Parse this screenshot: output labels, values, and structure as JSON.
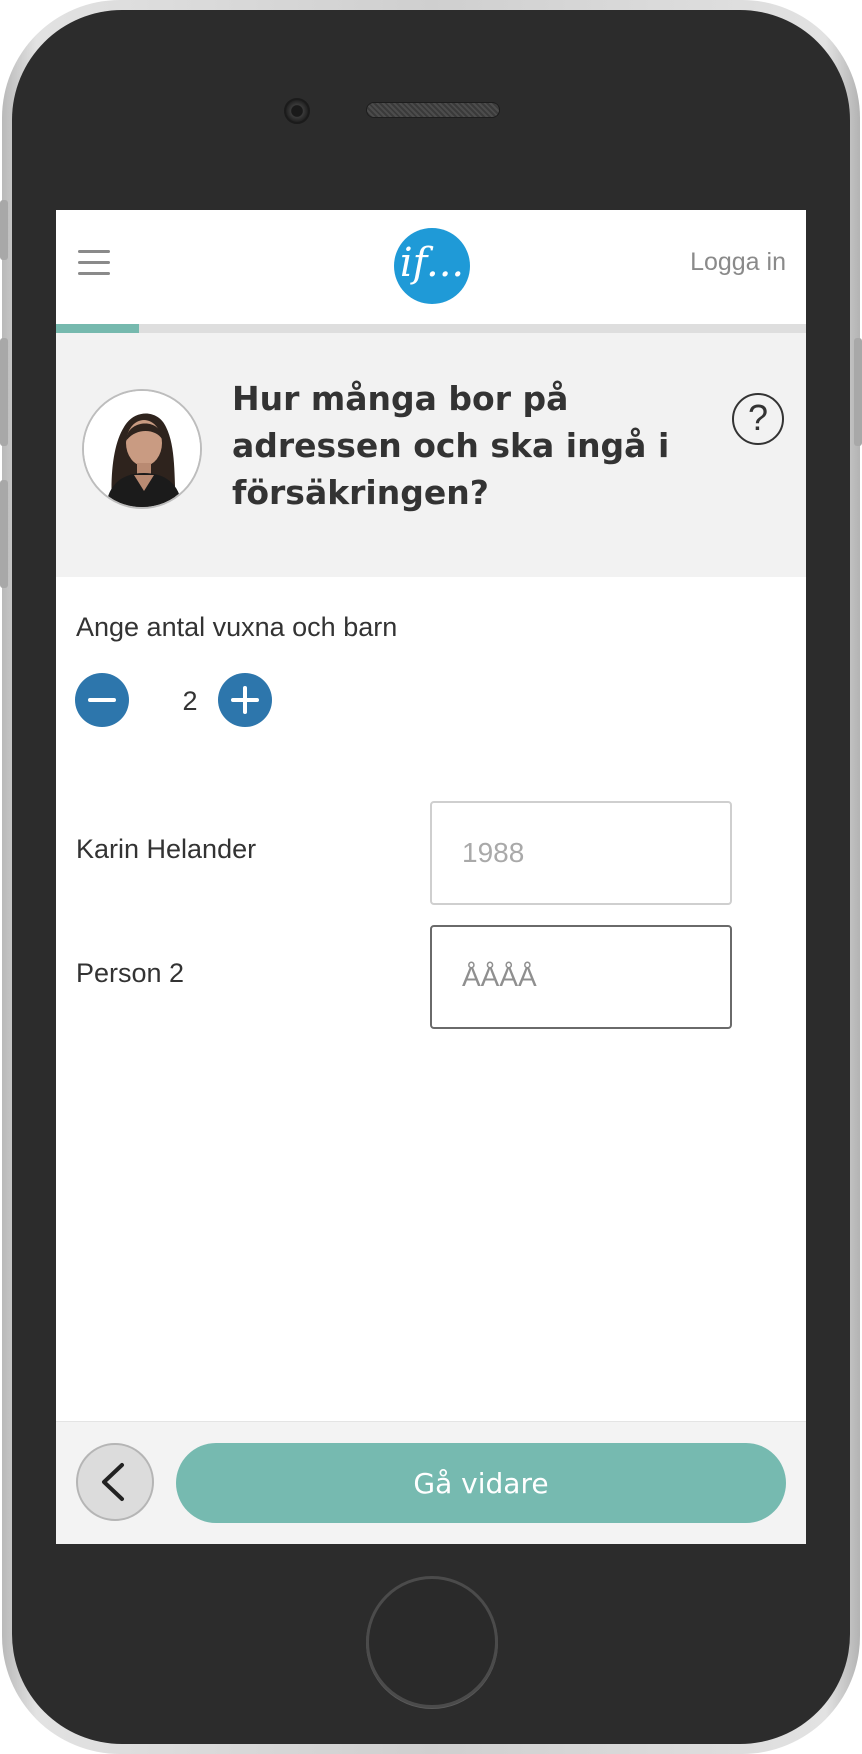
{
  "header": {
    "logo_text": "if...",
    "login_label": "Logga in"
  },
  "progress": {
    "fraction": 0.11
  },
  "question": {
    "title": "Hur många bor på adressen och ska ingå i försäkringen?",
    "help_label": "?"
  },
  "household": {
    "label": "Ange antal vuxna och barn",
    "count": "2"
  },
  "persons": [
    {
      "name": "Karin Helander",
      "year_value": "",
      "year_placeholder": "1988"
    },
    {
      "name": "Person 2",
      "year_value": "",
      "year_placeholder": "ÅÅÅÅ"
    }
  ],
  "footer": {
    "continue_label": "Gå vidare"
  },
  "colors": {
    "accent_teal": "#76bab0",
    "stepper_blue": "#2d76ac",
    "logo_blue": "#1f9ad7"
  }
}
